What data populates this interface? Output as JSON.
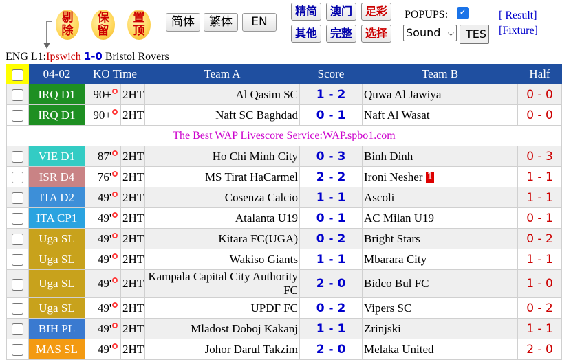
{
  "toolbar": {
    "circle_buttons": [
      {
        "label": "剔除",
        "name": "remove"
      },
      {
        "label": "保留",
        "name": "keep"
      },
      {
        "label": "置顶",
        "name": "pin-top"
      }
    ],
    "lang_buttons": [
      "简体",
      "繁体",
      "EN"
    ],
    "filter_row1": [
      "精简",
      "澳门",
      "足彩"
    ],
    "filter_row2": [
      "其他",
      "完整",
      "选择"
    ],
    "popups_label": "POPUPS:",
    "popups_checked": true,
    "sound_select": "Sound",
    "test_button": "TES",
    "result_link": "[ Result]",
    "fixture_link": "[Fixture]"
  },
  "goal_line": {
    "league": "ENG L1:",
    "home": "Ipswich",
    "score": "1-0",
    "away": "Bristol Rovers"
  },
  "table": {
    "headers": {
      "date": "04-02",
      "ko": "KO Time",
      "team_a": "Team A",
      "score": "Score",
      "team_b": "Team B",
      "half": "Half"
    },
    "rows": [
      {
        "league": "IRQ D1",
        "color": "#1e8f22",
        "minute": "90+",
        "status": "2HT",
        "team_a": "Al Qasim SC",
        "score": "1 - 2",
        "team_b": "Quwa Al Jawiya",
        "red_card": "",
        "half": "0 - 0"
      },
      {
        "league": "IRQ D1",
        "color": "#1e8f22",
        "minute": "90+",
        "status": "2HT",
        "team_a": "Naft SC Baghdad",
        "score": "0 - 1",
        "team_b": "Naft Al Wasat",
        "red_card": "",
        "half": "0 - 0"
      },
      {
        "ad": "The Best WAP Livescore Service:WAP.spbo1.com"
      },
      {
        "league": "VIE D1",
        "color": "#33ccc4",
        "minute": "87'",
        "status": "2HT",
        "team_a": "Ho Chi Minh City",
        "score": "0 - 3",
        "team_b": "Binh Dinh",
        "red_card": "",
        "half": "0 - 3"
      },
      {
        "league": "ISR D4",
        "color": "#c98385",
        "minute": "76'",
        "status": "2HT",
        "team_a": "MS Tirat HaCarmel",
        "score": "2 - 2",
        "team_b": "Ironi Nesher",
        "red_card": "1",
        "half": "1 - 1"
      },
      {
        "league": "ITA D2",
        "color": "#3d8fd8",
        "minute": "49'",
        "status": "2HT",
        "team_a": "Cosenza Calcio",
        "score": "1 - 1",
        "team_b": "Ascoli",
        "red_card": "",
        "half": "1 - 1"
      },
      {
        "league": "ITA CP1",
        "color": "#2aa3e0",
        "minute": "49'",
        "status": "2HT",
        "team_a": "Atalanta U19",
        "score": "0 - 1",
        "team_b": "AC Milan U19",
        "red_card": "",
        "half": "0 - 1"
      },
      {
        "league": "Uga SL",
        "color": "#c8a21c",
        "minute": "49'",
        "status": "2HT",
        "team_a": "Kitara FC(UGA)",
        "score": "0 - 2",
        "team_b": "Bright Stars",
        "red_card": "",
        "half": "0 - 2"
      },
      {
        "league": "Uga SL",
        "color": "#c8a21c",
        "minute": "49'",
        "status": "2HT",
        "team_a": "Wakiso Giants",
        "score": "1 - 1",
        "team_b": "Mbarara City",
        "red_card": "",
        "half": "1 - 1"
      },
      {
        "league": "Uga SL",
        "color": "#c8a21c",
        "minute": "49'",
        "status": "2HT",
        "team_a": "Kampala Capital City Authority FC",
        "score": "2 - 0",
        "team_b": "Bidco Bul FC",
        "red_card": "",
        "half": "1 - 0",
        "tall": true
      },
      {
        "league": "Uga SL",
        "color": "#c8a21c",
        "minute": "49'",
        "status": "2HT",
        "team_a": "UPDF FC",
        "score": "0 - 2",
        "team_b": "Vipers SC",
        "red_card": "",
        "half": "0 - 2"
      },
      {
        "league": "BIH PL",
        "color": "#3a7ad0",
        "minute": "49'",
        "status": "2HT",
        "team_a": "Mladost Doboj Kakanj",
        "score": "1 - 1",
        "team_b": "Zrinjski",
        "red_card": "",
        "half": "1 - 1"
      },
      {
        "league": "MAS SL",
        "color": "#f39a12",
        "minute": "49'",
        "status": "2HT",
        "team_a": "Johor Darul Takzim",
        "score": "2 - 0",
        "team_b": "Melaka United",
        "red_card": "",
        "half": "2 - 0"
      }
    ]
  }
}
